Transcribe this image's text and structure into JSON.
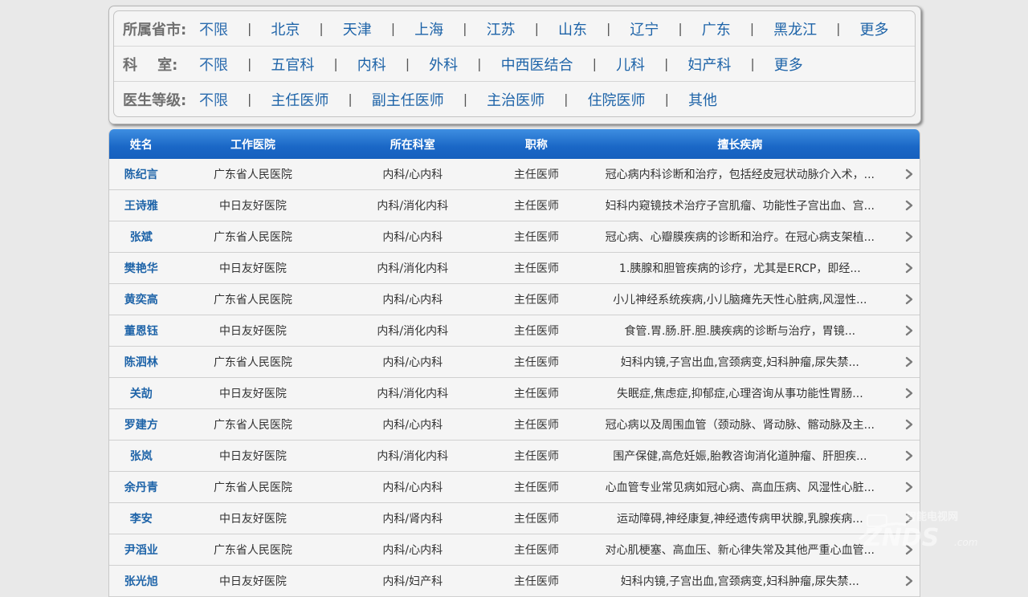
{
  "filters": [
    {
      "label": "所属省市:",
      "options": [
        "不限",
        "北京",
        "天津",
        "上海",
        "江苏",
        "山东",
        "辽宁",
        "广东",
        "黑龙江",
        "更多"
      ]
    },
    {
      "label": "科    室:",
      "options": [
        "不限",
        "五官科",
        "内科",
        "外科",
        "中西医结合",
        "儿科",
        "妇产科",
        "更多"
      ]
    },
    {
      "label": "医生等级:",
      "options": [
        "不限",
        "主任医师",
        "副主任医师",
        "主治医师",
        "住院医师",
        "其他"
      ]
    }
  ],
  "table": {
    "headers": [
      "姓名",
      "工作医院",
      "所在科室",
      "职称",
      "擅长疾病"
    ],
    "rows": [
      [
        "陈纪言",
        "广东省人民医院",
        "内科/心内科",
        "主任医师",
        "冠心病内科诊断和治疗，包括经皮冠状动脉介入术，..."
      ],
      [
        "王诗雅",
        "中日友好医院",
        "内科/消化内科",
        "主任医师",
        "妇科内窥镜技术治疗子宫肌瘤、功能性子宫出血、宫..."
      ],
      [
        "张斌",
        "广东省人民医院",
        "内科/心内科",
        "主任医师",
        "冠心病、心瓣膜疾病的诊断和治疗。在冠心病支架植..."
      ],
      [
        "樊艳华",
        "中日友好医院",
        "内科/消化内科",
        "主任医师",
        "1.胰腺和胆管疾病的诊疗，尤其是ERCP，即经..."
      ],
      [
        "黄奕高",
        "广东省人民医院",
        "内科/心内科",
        "主任医师",
        "小儿神经系统疾病,小儿脑瘫先天性心脏病,风湿性..."
      ],
      [
        "董恩钰",
        "中日友好医院",
        "内科/消化内科",
        "主任医师",
        "食管.胃.肠.肝.胆.胰疾病的诊断与治疗，胃镜..."
      ],
      [
        "陈泗林",
        "广东省人民医院",
        "内科/心内科",
        "主任医师",
        "妇科内镜,子宫出血,宫颈病变,妇科肿瘤,尿失禁..."
      ],
      [
        "关劼",
        "中日友好医院",
        "内科/消化内科",
        "主任医师",
        "失眠症,焦虑症,抑郁症,心理咨询从事功能性胃肠..."
      ],
      [
        "罗建方",
        "广东省人民医院",
        "内科/心内科",
        "主任医师",
        "冠心病以及周围血管（颈动脉、肾动脉、髂动脉及主..."
      ],
      [
        "张岚",
        "中日友好医院",
        "内科/消化内科",
        "主任医师",
        "围产保健,高危妊娠,胎教咨询消化道肿瘤、肝胆疾..."
      ],
      [
        "余丹青",
        "广东省人民医院",
        "内科/心内科",
        "主任医师",
        "心血管专业常见病如冠心病、高血压病、风湿性心脏..."
      ],
      [
        "李安",
        "中日友好医院",
        "内科/肾内科",
        "主任医师",
        "运动障碍,神经康复,神经遗传病甲状腺,乳腺疾病..."
      ],
      [
        "尹滔业",
        "广东省人民医院",
        "内科/心内科",
        "主任医师",
        "对心肌梗塞、高血压、新心律失常及其他严重心血管..."
      ],
      [
        "张光旭",
        "中日友好医院",
        "内科/妇产科",
        "主任医师",
        "妇科内镜,子宫出血,宫颈病变,妇科肿瘤,尿失禁..."
      ]
    ]
  },
  "watermark": {
    "top_text": "智能电视网",
    "brand": "ZNDS",
    "suffix": ".com"
  }
}
